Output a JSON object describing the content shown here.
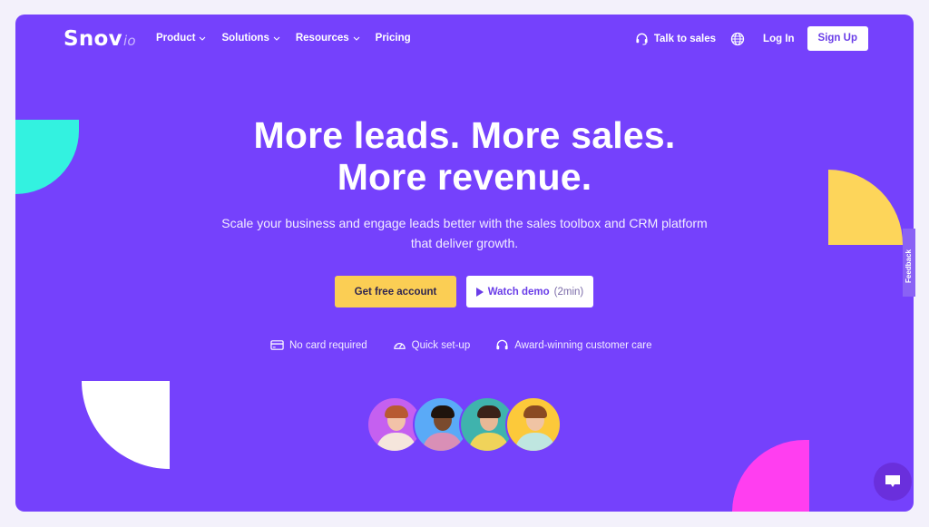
{
  "brand": {
    "name": "Snov",
    "suffix": "io"
  },
  "nav": {
    "menu": [
      {
        "label": "Product",
        "has_dropdown": true
      },
      {
        "label": "Solutions",
        "has_dropdown": true
      },
      {
        "label": "Resources",
        "has_dropdown": true
      },
      {
        "label": "Pricing",
        "has_dropdown": false
      }
    ],
    "talk_to_sales": "Talk to sales",
    "language_icon": "globe-icon",
    "login": "Log In",
    "signup": "Sign Up"
  },
  "hero": {
    "headline_line1": "More leads. More sales.",
    "headline_line2": "More revenue.",
    "subtitle_line1": "Scale your business and engage leads better with the sales toolbox and CRM platform",
    "subtitle_line2": "that deliver growth.",
    "primary_cta": "Get free account",
    "secondary_cta": "Watch demo",
    "secondary_cta_suffix": "(2min)",
    "features": [
      {
        "icon": "credit-card-icon",
        "label": "No card required"
      },
      {
        "icon": "speedometer-icon",
        "label": "Quick set-up"
      },
      {
        "icon": "headset-icon",
        "label": "Award-winning customer care"
      }
    ],
    "avatars": [
      {
        "bg": "#c560f0",
        "skin": "#f2c2a8",
        "hair": "#b85a32",
        "shirt": "#f5e6dc"
      },
      {
        "bg": "#5aaaf7",
        "skin": "#7a4a2e",
        "hair": "#1f140d",
        "shirt": "#d98fb6"
      },
      {
        "bg": "#3fb3ad",
        "skin": "#e8b896",
        "hair": "#3b2218",
        "shirt": "#f0d35a"
      },
      {
        "bg": "#fcc93a",
        "skin": "#f0c4a4",
        "hair": "#8a4a22",
        "shirt": "#bfe6e0"
      }
    ]
  },
  "side_tab": "Feedback",
  "colors": {
    "hero_bg": "#7541fc",
    "accent_yellow": "#fbce54",
    "accent_cyan": "#33f2e0",
    "accent_magenta": "#ff3ef0",
    "page_bg": "#f3f1fb"
  }
}
